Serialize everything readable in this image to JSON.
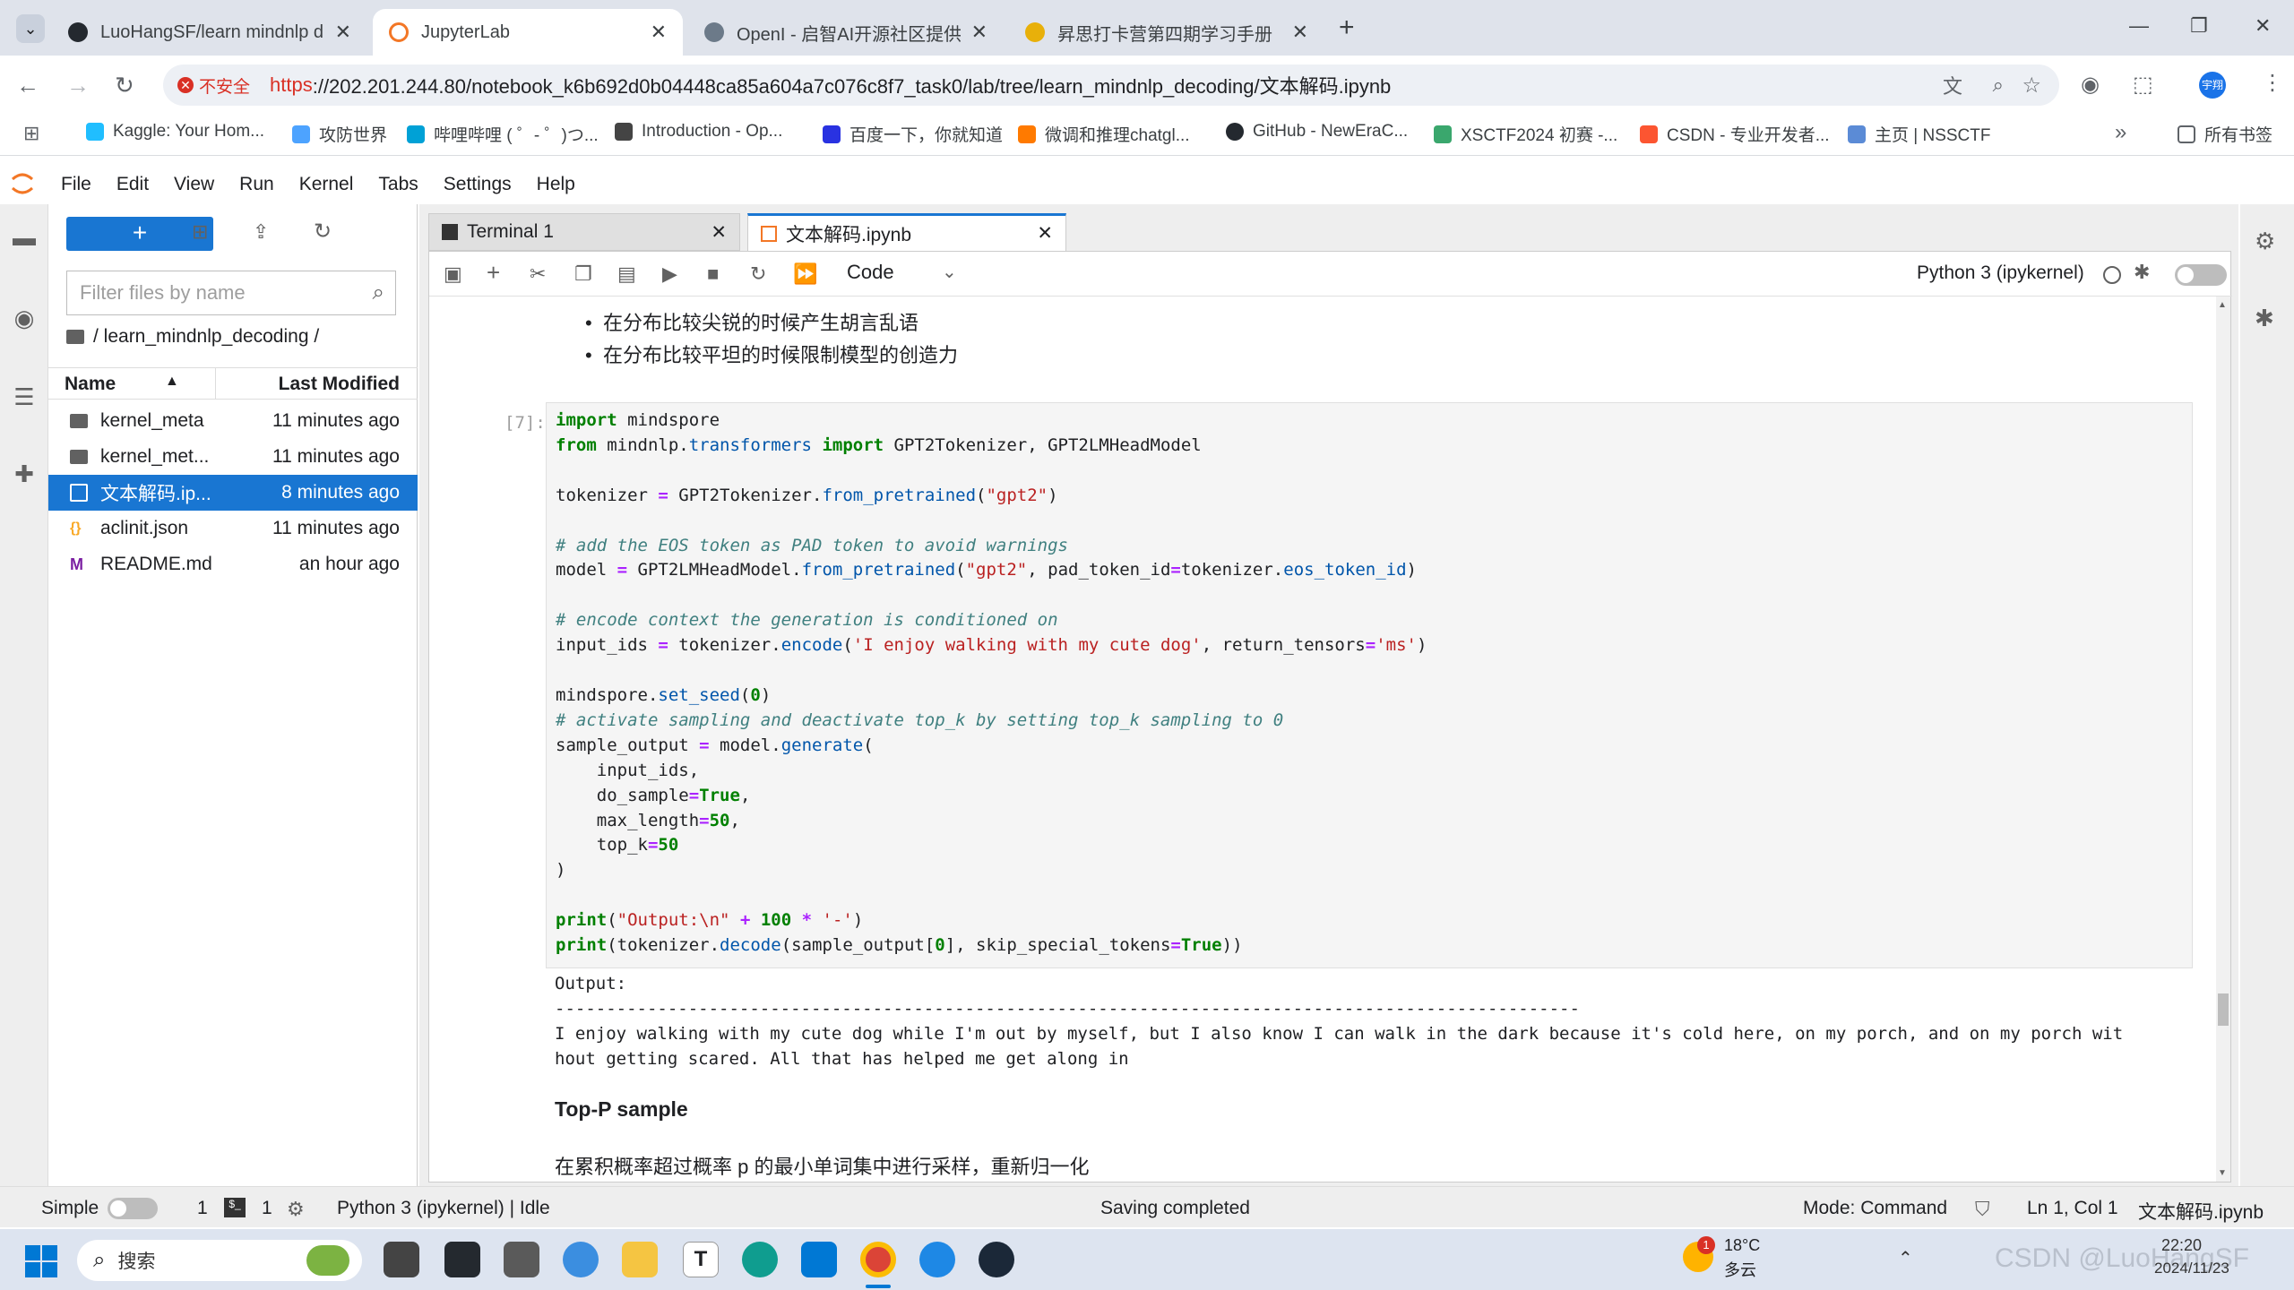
{
  "browser": {
    "tabs": [
      {
        "title": "LuoHangSF/learn mindnlp d",
        "close": "✕"
      },
      {
        "title": "JupyterLab",
        "close": "✕"
      },
      {
        "title": "OpenI - 启智AI开源社区提供普",
        "close": "✕"
      },
      {
        "title": "昇思打卡营第四期学习手册（后",
        "close": "✕"
      }
    ],
    "new_tab": "+",
    "window_controls": [
      "—",
      "❐",
      "✕"
    ],
    "security_label": "不安全",
    "url_scheme": "https",
    "url_rest": "://202.201.244.80/notebook_k6b692d0b04448ca85a604a7c076c8f7_task0/lab/tree/learn_mindnlp_decoding/文本解码.ipynb",
    "profile": "宇翔",
    "bookmarks": [
      "Kaggle: Your Hom...",
      "攻防世界",
      "哔哩哔哩 ( ゜- ゜)つ...",
      "Introduction - Op...",
      "百度一下，你就知道",
      "微调和推理chatgl...",
      "GitHub - NewEraC...",
      "XSCTF2024 初赛 -...",
      "CSDN - 专业开发者...",
      "主页 | NSSCTF"
    ],
    "bookmark_more": "»",
    "all_bookmarks": "所有书签"
  },
  "jupyter": {
    "menus": [
      "File",
      "Edit",
      "View",
      "Run",
      "Kernel",
      "Tabs",
      "Settings",
      "Help"
    ],
    "new_button": "+",
    "filter_placeholder": "Filter files by name",
    "breadcrumb": "/ learn_mindnlp_decoding /",
    "columns": {
      "name": "Name",
      "modified": "Last Modified"
    },
    "files": [
      {
        "name": "kernel_meta",
        "modified": "11 minutes ago",
        "kind": "folder"
      },
      {
        "name": "kernel_met...",
        "modified": "11 minutes ago",
        "kind": "folder"
      },
      {
        "name": "文本解码.ip...",
        "modified": "8 minutes ago",
        "kind": "notebook"
      },
      {
        "name": "aclinit.json",
        "modified": "11 minutes ago",
        "kind": "json"
      },
      {
        "name": "README.md",
        "modified": "an hour ago",
        "kind": "markdown"
      }
    ],
    "doc_tabs": [
      {
        "title": "Terminal 1",
        "close": "✕"
      },
      {
        "title": "文本解码.ipynb",
        "close": "✕"
      }
    ],
    "cell_type": "Code",
    "kernel_name": "Python 3 (ipykernel)",
    "md_bullets": [
      "在分布比较尖锐的时候产生胡言乱语",
      "在分布比较平坦的时候限制模型的创造力"
    ],
    "prompt": "[7]:",
    "output_label": "Output:",
    "output_dashes": "----------------------------------------------------------------------------------------------------",
    "output_line1": "I enjoy walking with my cute dog while I'm out by myself, but I also know I can walk in the dark because it's cold here, on my porch, and on my porch wit",
    "output_line2": "hout getting scared. All that has helped me get along in",
    "heading": "Top-P sample",
    "paragraph": "在累积概率超过概率 p 的最小单词集中进行采样，重新归一化"
  },
  "status": {
    "mode_label": "Simple",
    "terminals": "1",
    "kernels": "1",
    "kernel_status": "Python 3 (ipykernel) | Idle",
    "save_status": "Saving completed",
    "mode": "Mode: Command",
    "position": "Ln 1, Col 1",
    "filename": "文本解码.ipynb"
  },
  "taskbar": {
    "search": "搜索",
    "weather_temp": "18°C",
    "weather_desc": "多云",
    "weather_badge": "1",
    "time": "22:20",
    "date": "2024/11/23",
    "watermark": "CSDN @LuoHangSF"
  },
  "colors": {
    "accent": "#1976d2",
    "jupyter_orange": "#f37726",
    "keyword": "#008000",
    "string": "#ba2121",
    "comment": "#408080"
  }
}
